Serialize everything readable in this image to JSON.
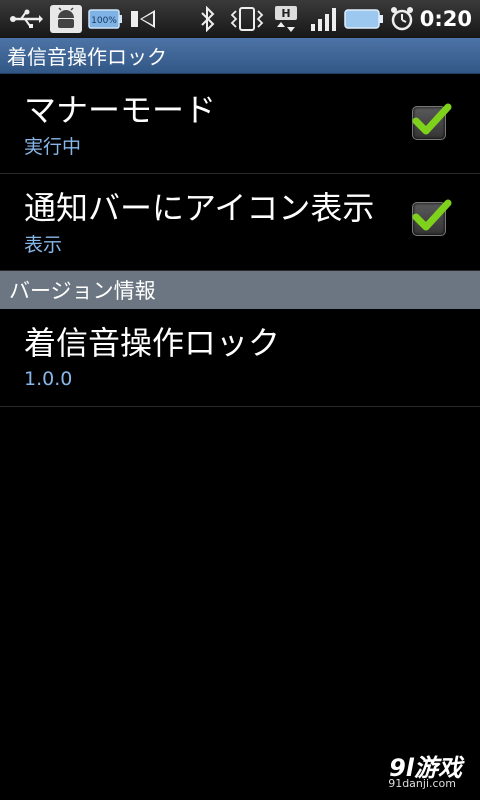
{
  "status_bar": {
    "time": "0:20",
    "battery_percent_label": "100%",
    "icons": [
      "usb-icon",
      "android-debug-icon",
      "battery-100-icon",
      "media-icon",
      "bluetooth-icon",
      "vibrate-icon",
      "hsdpa-data-icon",
      "signal-icon",
      "battery-icon",
      "alarm-icon"
    ]
  },
  "title_bar": {
    "title": "着信音操作ロック"
  },
  "preferences": [
    {
      "title": "マナーモード",
      "summary": "実行中",
      "checked": true
    },
    {
      "title": "通知バーにアイコン表示",
      "summary": "表示",
      "checked": true
    }
  ],
  "category": {
    "label": "バージョン情報"
  },
  "version_item": {
    "title": "着信音操作ロック",
    "summary": "1.0.0"
  },
  "watermark": {
    "logo": "9l游戏",
    "url": "91danji.com"
  },
  "colors": {
    "title_bar": "#3f6697",
    "summary_text": "#87b7e9",
    "checkmark": "#7fd21b",
    "category_bg": "#6b7682"
  }
}
